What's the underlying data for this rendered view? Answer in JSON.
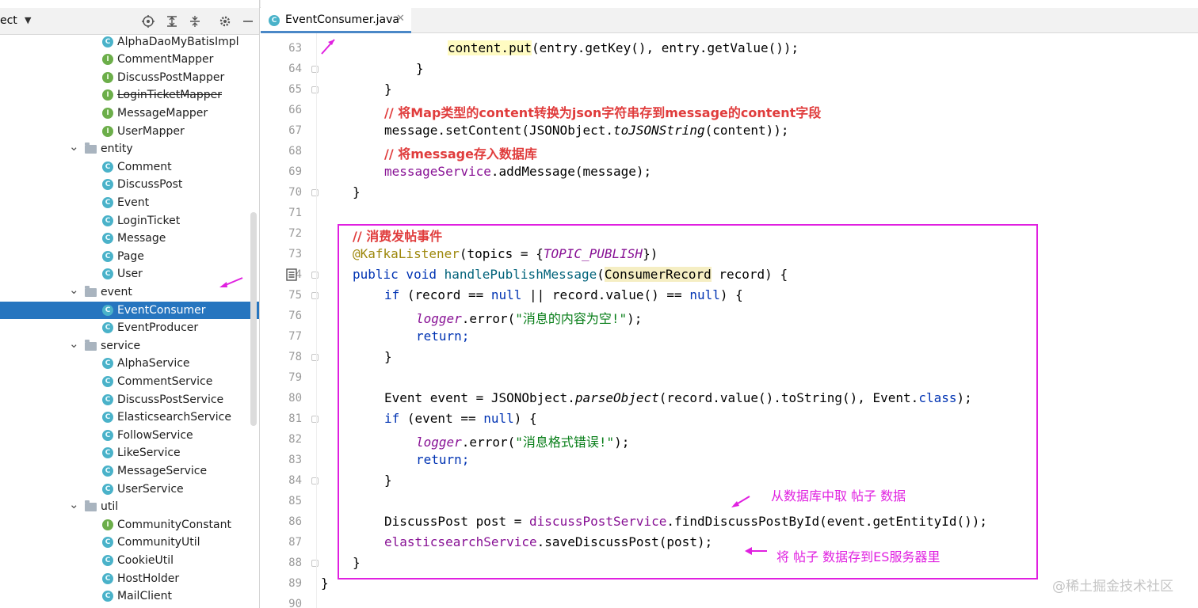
{
  "project_panel": {
    "title": "ect",
    "tree": [
      {
        "label": "AlphaDaoMyBatisImpl",
        "kind": "class",
        "indent": 2
      },
      {
        "label": "CommentMapper",
        "kind": "interface",
        "indent": 2
      },
      {
        "label": "DiscussPostMapper",
        "kind": "interface",
        "indent": 2
      },
      {
        "label": "LoginTicketMapper",
        "kind": "interface",
        "indent": 2,
        "deprecated": true
      },
      {
        "label": "MessageMapper",
        "kind": "interface",
        "indent": 2
      },
      {
        "label": "UserMapper",
        "kind": "interface",
        "indent": 2
      },
      {
        "label": "entity",
        "kind": "folder",
        "indent": 1
      },
      {
        "label": "Comment",
        "kind": "class",
        "indent": 2
      },
      {
        "label": "DiscussPost",
        "kind": "class",
        "indent": 2
      },
      {
        "label": "Event",
        "kind": "class",
        "indent": 2
      },
      {
        "label": "LoginTicket",
        "kind": "class",
        "indent": 2
      },
      {
        "label": "Message",
        "kind": "class",
        "indent": 2
      },
      {
        "label": "Page",
        "kind": "class",
        "indent": 2
      },
      {
        "label": "User",
        "kind": "class",
        "indent": 2
      },
      {
        "label": "event",
        "kind": "folder",
        "indent": 1
      },
      {
        "label": "EventConsumer",
        "kind": "class",
        "indent": 2,
        "selected": true
      },
      {
        "label": "EventProducer",
        "kind": "class",
        "indent": 2
      },
      {
        "label": "service",
        "kind": "folder",
        "indent": 1
      },
      {
        "label": "AlphaService",
        "kind": "class",
        "indent": 2
      },
      {
        "label": "CommentService",
        "kind": "class",
        "indent": 2
      },
      {
        "label": "DiscussPostService",
        "kind": "class",
        "indent": 2
      },
      {
        "label": "ElasticsearchService",
        "kind": "class",
        "indent": 2
      },
      {
        "label": "FollowService",
        "kind": "class",
        "indent": 2
      },
      {
        "label": "LikeService",
        "kind": "class",
        "indent": 2
      },
      {
        "label": "MessageService",
        "kind": "class",
        "indent": 2
      },
      {
        "label": "UserService",
        "kind": "class",
        "indent": 2
      },
      {
        "label": "util",
        "kind": "folder",
        "indent": 1
      },
      {
        "label": "CommunityConstant",
        "kind": "interface",
        "indent": 2
      },
      {
        "label": "CommunityUtil",
        "kind": "class",
        "indent": 2
      },
      {
        "label": "CookieUtil",
        "kind": "class",
        "indent": 2
      },
      {
        "label": "HostHolder",
        "kind": "class",
        "indent": 2
      },
      {
        "label": "MailClient",
        "kind": "class",
        "indent": 2
      }
    ]
  },
  "editor": {
    "tab_label": "EventConsumer.java",
    "line_numbers": [
      "63",
      "64",
      "65",
      "66",
      "67",
      "68",
      "69",
      "70",
      "71",
      "72",
      "73",
      "74",
      "75",
      "76",
      "77",
      "78",
      "79",
      "80",
      "81",
      "82",
      "83",
      "84",
      "85",
      "86",
      "87",
      "88",
      "89",
      "90"
    ],
    "code": {
      "l63_obj": "content.put",
      "l63_rest": "(entry.getKey(), entry.getValue());",
      "l64": "}",
      "l65": "}",
      "l66": "// 将Map类型的content转换为json字符串存到message的content字段",
      "l67_a": "message.setContent(JSONObject.",
      "l67_b": "toJSONString",
      "l67_c": "(content));",
      "l68": "// 将message存入数据库",
      "l69_a": "messageService",
      "l69_b": ".addMessage(message);",
      "l70": "}",
      "l72": "// 消费发帖事件",
      "l73_a": "@KafkaListener",
      "l73_b": "(topics = {",
      "l73_c": "TOPIC_PUBLISH",
      "l73_d": "})",
      "l74_a": "public void ",
      "l74_b": "handlePublishMessage",
      "l74_c": "(",
      "l74_d": "ConsumerRecord",
      "l74_e": " record) {",
      "l75_a": "if",
      "l75_b": " (record == ",
      "l75_c": "null",
      "l75_d": " || record.value() == ",
      "l75_e": "null",
      "l75_f": ") {",
      "l76_a": "logger",
      "l76_b": ".error(",
      "l76_c": "\"消息的内容为空!\"",
      "l76_d": ");",
      "l77": "return;",
      "l78": "}",
      "l80_a": "Event event = JSONObject.",
      "l80_b": "parseObject",
      "l80_c": "(record.value().toString(), Event.",
      "l80_d": "class",
      "l80_e": ");",
      "l81_a": "if",
      "l81_b": " (event == ",
      "l81_c": "null",
      "l81_d": ") {",
      "l82_a": "logger",
      "l82_b": ".error(",
      "l82_c": "\"消息格式错误!\"",
      "l82_d": ");",
      "l83": "return;",
      "l84": "}",
      "l86_a": "DiscussPost post = ",
      "l86_b": "discussPostService",
      "l86_c": ".findDiscussPostById(event.getEntityId());",
      "l87_a": "elasticsearchService",
      "l87_b": ".saveDiscussPost(post);",
      "l88": "}",
      "l89": "}"
    },
    "notes": {
      "fetch": "从数据库中取 帖子 数据",
      "save": "将 帖子 数据存到ES服务器里"
    }
  },
  "watermark": "@稀土掘金技术社区",
  "colors": {
    "selection": "#2675bf",
    "annotation": "#e020e0",
    "keyword": "#0033b3",
    "comment": "#e03c3c",
    "string": "#067d17",
    "field": "#871094"
  },
  "icons": [
    "locate-icon",
    "expand-all-icon",
    "collapse-all-icon",
    "gear-icon",
    "minimize-icon",
    "class-icon",
    "interface-icon",
    "folder-icon",
    "close-icon"
  ]
}
